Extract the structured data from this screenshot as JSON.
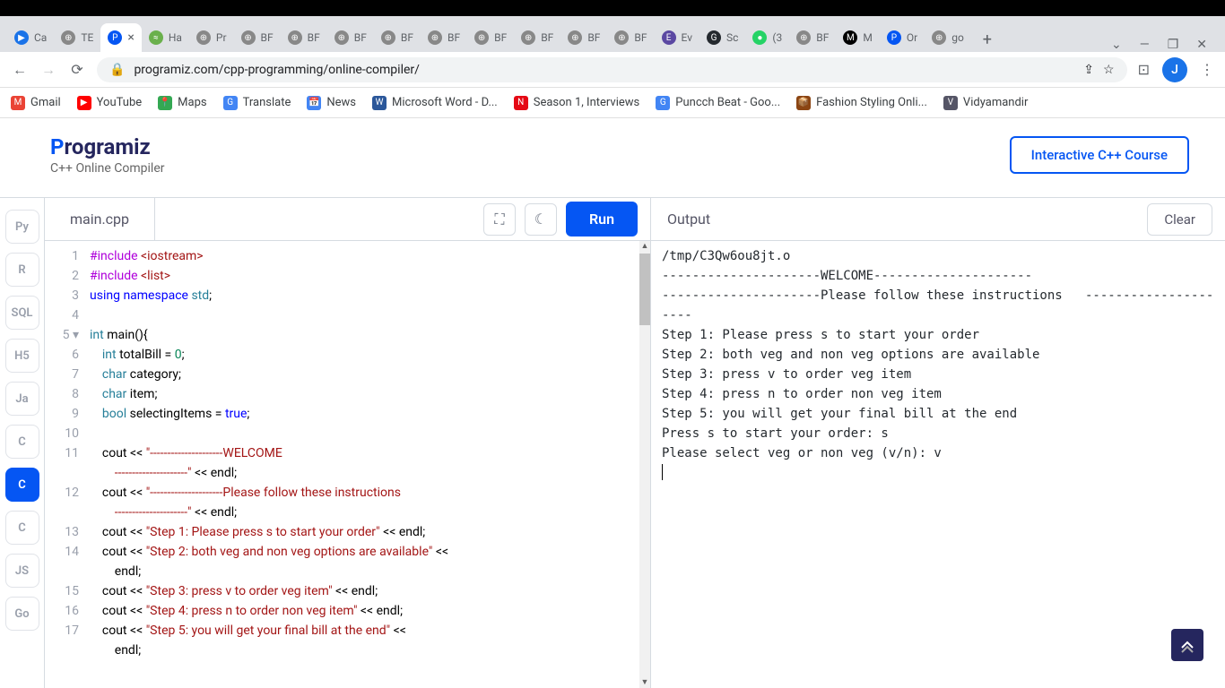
{
  "browser": {
    "tabs": [
      {
        "favicon_bg": "#1a73e8",
        "favicon_text": "▶",
        "label": "Ca"
      },
      {
        "favicon_bg": "#888",
        "favicon_text": "⊕",
        "label": "TE"
      },
      {
        "favicon_bg": "#0556f3",
        "favicon_text": "P",
        "label": "",
        "active": true
      },
      {
        "favicon_bg": "#6ab04c",
        "favicon_text": "≈",
        "label": "Ha"
      },
      {
        "favicon_bg": "#888",
        "favicon_text": "⊕",
        "label": "Pr"
      },
      {
        "favicon_bg": "#888",
        "favicon_text": "⊕",
        "label": "BF"
      },
      {
        "favicon_bg": "#888",
        "favicon_text": "⊕",
        "label": "BF"
      },
      {
        "favicon_bg": "#888",
        "favicon_text": "⊕",
        "label": "BF"
      },
      {
        "favicon_bg": "#888",
        "favicon_text": "⊕",
        "label": "BF"
      },
      {
        "favicon_bg": "#888",
        "favicon_text": "⊕",
        "label": "BF"
      },
      {
        "favicon_bg": "#888",
        "favicon_text": "⊕",
        "label": "BF"
      },
      {
        "favicon_bg": "#888",
        "favicon_text": "⊕",
        "label": "BF"
      },
      {
        "favicon_bg": "#888",
        "favicon_text": "⊕",
        "label": "BF"
      },
      {
        "favicon_bg": "#888",
        "favicon_text": "⊕",
        "label": "BF"
      },
      {
        "favicon_bg": "#5b48a2",
        "favicon_text": "E",
        "label": "Ev"
      },
      {
        "favicon_bg": "#24292e",
        "favicon_text": "G",
        "label": "Sc"
      },
      {
        "favicon_bg": "#25d366",
        "favicon_text": "●",
        "label": "(3"
      },
      {
        "favicon_bg": "#888",
        "favicon_text": "⊕",
        "label": "BF"
      },
      {
        "favicon_bg": "#000",
        "favicon_text": "M",
        "label": "M"
      },
      {
        "favicon_bg": "#0556f3",
        "favicon_text": "P",
        "label": "Or"
      },
      {
        "favicon_bg": "#888",
        "favicon_text": "⊕",
        "label": "go"
      }
    ],
    "url": "programiz.com/cpp-programming/online-compiler/",
    "avatar_letter": "J",
    "bookmarks": [
      {
        "icon": "M",
        "icon_bg": "#ea4335",
        "label": "Gmail"
      },
      {
        "icon": "▶",
        "icon_bg": "#ff0000",
        "label": "YouTube"
      },
      {
        "icon": "📍",
        "icon_bg": "#34a853",
        "label": "Maps"
      },
      {
        "icon": "G",
        "icon_bg": "#4285f4",
        "label": "Translate"
      },
      {
        "icon": "📅",
        "icon_bg": "#4285f4",
        "label": "News"
      },
      {
        "icon": "W",
        "icon_bg": "#2b579a",
        "label": "Microsoft Word - D..."
      },
      {
        "icon": "N",
        "icon_bg": "#e50914",
        "label": "Season 1, Interviews"
      },
      {
        "icon": "G",
        "icon_bg": "#4285f4",
        "label": "Puncch Beat - Goo..."
      },
      {
        "icon": "📦",
        "icon_bg": "#8b4513",
        "label": "Fashion Styling Onli..."
      },
      {
        "icon": "V",
        "icon_bg": "#556",
        "label": "Vidyamandir"
      }
    ]
  },
  "header": {
    "logo_prefix": "P",
    "logo_rest": "rogramiz",
    "subtitle": "C++ Online Compiler",
    "course_button": "Interactive C++ Course"
  },
  "sidebar": {
    "languages": [
      "Py",
      "R",
      "SQL",
      "H5",
      "Ja",
      "C",
      "C",
      "C",
      "JS",
      "Go"
    ],
    "active_index": 6
  },
  "editor": {
    "filename": "main.cpp",
    "run_label": "Run",
    "line_numbers": [
      "1",
      "2",
      "3",
      "4",
      "5 ▾",
      "6",
      "7",
      "8",
      "9",
      "10",
      "11",
      "",
      "12",
      "",
      "13",
      "14",
      "",
      "15",
      "16",
      "17",
      ""
    ],
    "code_lines_html": [
      "<span class='pp'>#include</span> <span class='inc'>&lt;iostream&gt;</span>",
      "<span class='pp'>#include</span> <span class='inc'>&lt;list&gt;</span>",
      "<span class='kw'>using</span> <span class='kw'>namespace</span> <span class='ns'>std</span>;",
      "",
      "<span class='type'>int</span> main(){",
      "    <span class='type'>int</span> totalBill = <span class='num'>0</span>;",
      "    <span class='type'>char</span> category;",
      "    <span class='type'>char</span> item;",
      "    <span class='type'>bool</span> selectingItems = <span class='bool'>true</span>;",
      "",
      "    cout &lt;&lt; <span class='str'>\"---------------------WELCOME</span>",
      "        <span class='str'>---------------------\"</span> &lt;&lt; endl;",
      "    cout &lt;&lt; <span class='str'>\"---------------------Please follow these instructions</span>",
      "        <span class='str'>---------------------\"</span> &lt;&lt; endl;",
      "    cout &lt;&lt; <span class='str'>\"Step 1: Please press s to start your order\"</span> &lt;&lt; endl;",
      "    cout &lt;&lt; <span class='str'>\"Step 2: both veg and non veg options are available\"</span> &lt;&lt;",
      "        endl;",
      "    cout &lt;&lt; <span class='str'>\"Step 3: press v to order veg item\"</span> &lt;&lt; endl;",
      "    cout &lt;&lt; <span class='str'>\"Step 4: press n to order non veg item\"</span> &lt;&lt; endl;",
      "    cout &lt;&lt; <span class='str'>\"Step 5: you will get your final bill at the end\"</span> &lt;&lt;",
      "        endl;"
    ]
  },
  "output": {
    "label": "Output",
    "clear_label": "Clear",
    "lines": [
      "/tmp/C3Qw6ou8jt.o",
      "---------------------WELCOME---------------------",
      "---------------------Please follow these instructions   ---------------------",
      "Step 1: Please press s to start your order",
      "Step 2: both veg and non veg options are available",
      "Step 3: press v to order veg item",
      "Step 4: press n to order non veg item",
      "Step 5: you will get your final bill at the end",
      "Press s to start your order: s",
      "Please select veg or non veg (v/n): v"
    ]
  }
}
